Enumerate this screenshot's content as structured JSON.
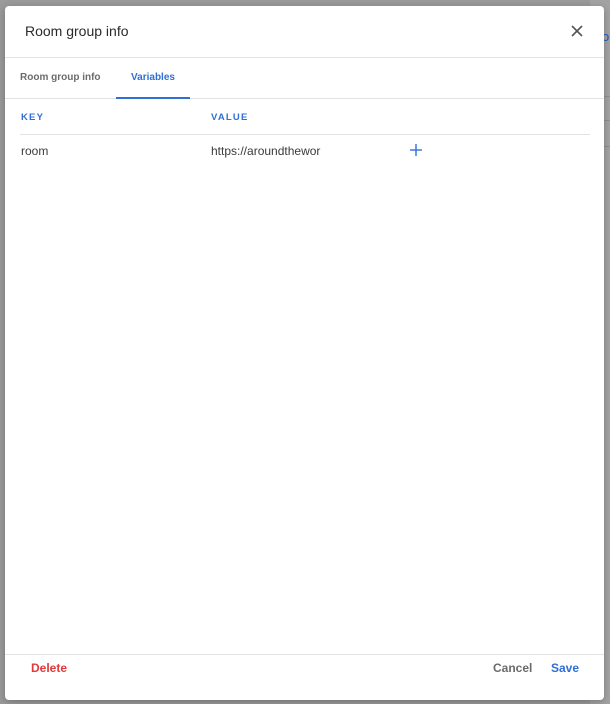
{
  "background": {
    "partial_text": "o"
  },
  "dialog": {
    "title": "Room group info",
    "tabs": [
      {
        "label": "Room group info",
        "active": false
      },
      {
        "label": "Variables",
        "active": true
      }
    ],
    "table": {
      "headers": [
        "KEY",
        "VALUE"
      ],
      "rows": [
        {
          "key": "room",
          "value": "https://aroundthewor"
        }
      ]
    },
    "footer": {
      "delete_label": "Delete",
      "cancel_label": "Cancel",
      "save_label": "Save"
    }
  },
  "colors": {
    "accent": "#2f6fd6",
    "danger": "#e03a3a",
    "overlay": "#9a9a9a"
  }
}
